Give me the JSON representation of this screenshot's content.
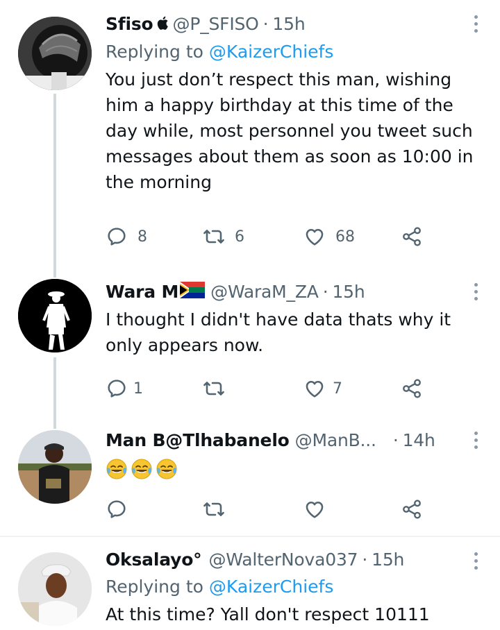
{
  "tweets": [
    {
      "name": "Sfiso",
      "handle": "@P_SFISO",
      "dot": "·",
      "time": "15h",
      "replying_prefix": "Replying to",
      "replying_to": "@KaizerChiefs",
      "text": "You just don’t respect this man, wishing him a happy birthday at this time of the day while, most personnel you tweet such messages about them as soon as 10:00 in the morning",
      "replies": "8",
      "retweets": "6",
      "likes": "68"
    },
    {
      "name": "Wara M",
      "handle": "@WaraM_ZA",
      "dot": "·",
      "time": "15h",
      "text": "I thought I didn't have data thats why it only appears now.",
      "replies": "1",
      "retweets": "",
      "likes": "7"
    },
    {
      "name": "Man B@Tlhabanelo",
      "handle": "@ManB...",
      "dot": "·",
      "time": "14h",
      "emoji_count": 3,
      "replies": "",
      "retweets": "",
      "likes": ""
    },
    {
      "name": "Oksalayo°",
      "handle": "@WalterNova037",
      "dot": "·",
      "time": "15h",
      "replying_prefix": "Replying to",
      "replying_to": "@KaizerChiefs",
      "text": "At this time? Yall don't respect 10111"
    }
  ],
  "icons": [
    "apple-icon",
    "south-africa-flag-icon",
    "reply-icon",
    "retweet-icon",
    "like-icon",
    "share-icon",
    "more-icon",
    "joy-emoji-icon"
  ],
  "colors": {
    "link": "#1d9bf0",
    "muted": "#536471",
    "text": "#0f1419",
    "thread_line": "#cfd9de"
  }
}
